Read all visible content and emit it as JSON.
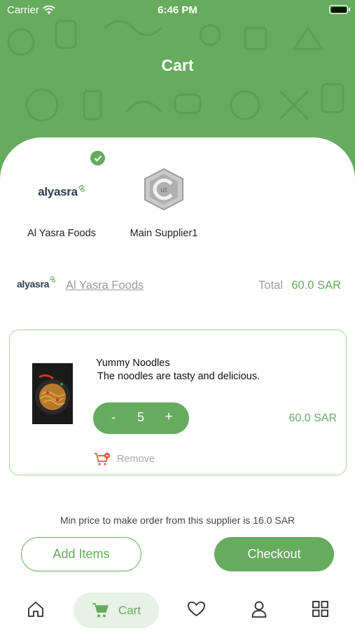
{
  "status_bar": {
    "carrier": "Carrier",
    "time": "6:46 PM"
  },
  "header": {
    "title": "Cart"
  },
  "suppliers": [
    {
      "logo_text": "alyasra",
      "name": "Al Yasra Foods",
      "selected": true
    },
    {
      "logo_text": "ut",
      "name": "Main Supplier1",
      "selected": false
    }
  ],
  "store": {
    "logo_text": "alyasra",
    "name": "Al Yasra Foods",
    "total_label": "Total",
    "total_value": "60.0 SAR"
  },
  "cart_item": {
    "title": "Yummy Noodles",
    "description": "The noodles are tasty and delicious.",
    "minus": "-",
    "quantity": "5",
    "plus": "+",
    "price": "60.0 SAR",
    "remove_label": "Remove"
  },
  "min_price_note": "Min price to make order from this supplier is 16.0 SAR",
  "actions": {
    "add_items": "Add Items",
    "checkout": "Checkout"
  },
  "tab_bar": {
    "active_label": "Cart",
    "tabs": [
      "home-icon",
      "cart-icon",
      "heart-icon",
      "user-icon",
      "grid-icon"
    ]
  },
  "colors": {
    "primary": "#66ab5e",
    "border": "#a8d3a2",
    "tab_active_bg": "#e7f1e6"
  }
}
